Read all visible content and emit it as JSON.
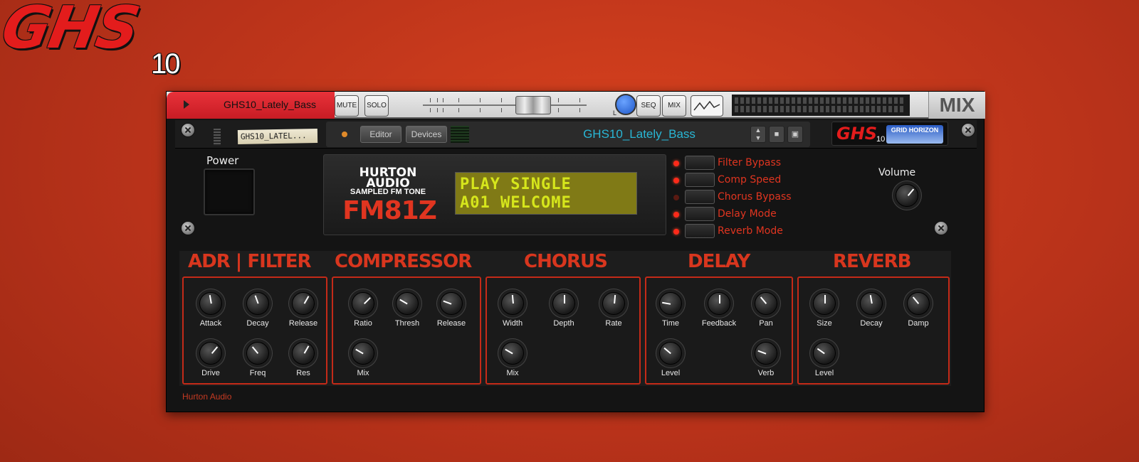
{
  "logo": {
    "main": "GHS",
    "sub": "10"
  },
  "mixer_strip": {
    "track_name": "GHS10_Lately_Bass",
    "mute_label": "MUTE",
    "solo_label": "SOLO",
    "pan_left": "L",
    "pan_right": "R",
    "seq_label": "SEQ",
    "mix_btn_label": "MIX",
    "mix_title": "MIX"
  },
  "header": {
    "tape_label": "GHS10_LATEL...",
    "editor_label": "Editor",
    "devices_label": "Devices",
    "patch_name": "GHS10_Lately_Bass",
    "badge_text": "GHS",
    "badge_sub": "10",
    "badge_partner": "GRID HORIZON"
  },
  "device": {
    "power_label": "Power",
    "brand_line1": "HURTON AUDIO",
    "brand_line2": "SAMPLED FM TONE",
    "brand_model": "FM81Z",
    "lcd_line1": "PLAY SINGLE",
    "lcd_line2": "A01 WELCOME",
    "modes": [
      {
        "label": "Filter Bypass",
        "on": true
      },
      {
        "label": "Comp Speed",
        "on": true
      },
      {
        "label": "Chorus Bypass",
        "on": false
      },
      {
        "label": "Delay Mode",
        "on": true
      },
      {
        "label": "Reverb Mode",
        "on": true
      }
    ],
    "volume_label": "Volume"
  },
  "sections": {
    "adr_filter": {
      "title": "ADR | FILTER",
      "knobs": [
        "Attack",
        "Decay",
        "Release",
        "Drive",
        "Freq",
        "Res"
      ]
    },
    "compressor": {
      "title": "COMPRESSOR",
      "knobs": [
        "Ratio",
        "Thresh",
        "Release",
        "Mix"
      ]
    },
    "chorus": {
      "title": "CHORUS",
      "knobs": [
        "Width",
        "Depth",
        "Rate",
        "Mix"
      ]
    },
    "delay": {
      "title": "DELAY",
      "knobs": [
        "Time",
        "Feedback",
        "Pan",
        "Level",
        "Verb"
      ]
    },
    "reverb": {
      "title": "REVERB",
      "knobs": [
        "Size",
        "Decay",
        "Damp",
        "Level"
      ]
    }
  },
  "footer": "Hurton Audio",
  "colors": {
    "accent": "#d8361e",
    "patch": "#29b6d5",
    "lcd_text": "#d6e61c"
  }
}
